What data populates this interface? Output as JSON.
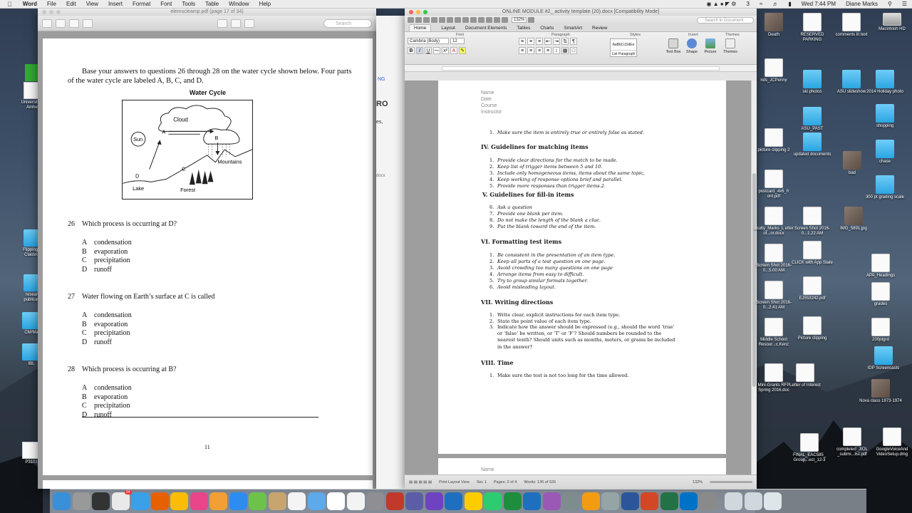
{
  "menubar": {
    "app": "Word",
    "items": [
      "File",
      "Edit",
      "View",
      "Insert",
      "Format",
      "Font",
      "Tools",
      "Table",
      "Window",
      "Help"
    ],
    "clock": "Wed 7:44 PM",
    "user": "Diane Marks",
    "battery_label": "3"
  },
  "pdf": {
    "title": "elemscieamp.pdf (page 17 of 34)",
    "search_placeholder": "Search",
    "intro": "Base your answers to questions 26 through 28 on the water cycle shown below.  Four parts of the water cycle are labeled A, B, C, and D.",
    "diagram_title": "Water Cycle",
    "diagram_labels": {
      "cloud": "Cloud",
      "sun": "Sun",
      "a": "A",
      "b": "B",
      "c": "C",
      "d": "D",
      "mountains": "Mountains",
      "lake": "Lake",
      "forest": "Forest"
    },
    "questions": [
      {
        "num": "26",
        "text": "Which process is occurring at D?",
        "options": [
          {
            "l": "A",
            "t": "condensation"
          },
          {
            "l": "B",
            "t": "evaporation"
          },
          {
            "l": "C",
            "t": "precipitation"
          },
          {
            "l": "D",
            "t": "runoff"
          }
        ]
      },
      {
        "num": "27",
        "text": "Water flowing on Earth’s surface at C is called",
        "options": [
          {
            "l": "A",
            "t": "condensation"
          },
          {
            "l": "B",
            "t": "evaporation"
          },
          {
            "l": "C",
            "t": "precipitation"
          },
          {
            "l": "D",
            "t": "runoff"
          }
        ]
      },
      {
        "num": "28",
        "text": "Which process is occurring at B?",
        "options": [
          {
            "l": "A",
            "t": "condensation"
          },
          {
            "l": "B",
            "t": "evaporation"
          },
          {
            "l": "C",
            "t": "precipitation"
          },
          {
            "l": "D",
            "t": "runoff"
          }
        ]
      }
    ],
    "page_number": "11"
  },
  "middle_window": {
    "fragments": [
      "NG",
      "RO",
      "es,",
      "docx"
    ]
  },
  "word": {
    "title": "ONLINE MODULE #2_ activity template (20).docx [Compatibility Mode]",
    "search_placeholder": "Search in Document",
    "zoom": "132%",
    "tabs": [
      "Home",
      "Layout",
      "Document Elements",
      "Tables",
      "Charts",
      "SmartArt",
      "Review"
    ],
    "ribbon_groups": [
      "Font",
      "Paragraph",
      "Styles",
      "Insert",
      "Themes"
    ],
    "font_name": "Cambria (Body)",
    "font_size": "12",
    "style_preview": "AaBbCcDdEe",
    "style_name": "List Paragraph",
    "insert_buttons": [
      "Text Box",
      "Shape",
      "Picture"
    ],
    "themes_button": "Themes",
    "header_lines": [
      "Name",
      "Date",
      "Course",
      "Instructor"
    ],
    "item_top": {
      "n": "1.",
      "t": "Make sure the item is entirely true or entirely false as stated."
    },
    "sections": [
      {
        "heading": "IV. Guidelines for matching items",
        "items": [
          {
            "n": "1.",
            "t": "Provide clear directions for the match to be made."
          },
          {
            "n": "2.",
            "t": "Keep list of trigger items between 5 and 10."
          },
          {
            "n": "3.",
            "t": "Include only homogeneous items, items about the same topic,"
          },
          {
            "n": "4.",
            "t": "Keep working of response options brief and parallel."
          },
          {
            "n": "5.",
            "t": "Provide more responses than trigger items.2."
          }
        ]
      },
      {
        "heading": "V.  Guidelines for fill-in items",
        "items": [
          {
            "n": "6.",
            "t": "Ask a question"
          },
          {
            "n": "7.",
            "t": "Provide one blank per item."
          },
          {
            "n": "8.",
            "t": "Do not make the length of the blank a clue."
          },
          {
            "n": "9.",
            "t": "Put the blank toward the end of the item."
          }
        ]
      },
      {
        "heading": "VI. Formatting test items",
        "items": [
          {
            "n": "1.",
            "t": "Be consistent in the presentation of an item type."
          },
          {
            "n": "2.",
            "t": "Keep all parts of a test question on one page."
          },
          {
            "n": "3.",
            "t": "Avoid crowding too many questions on one page"
          },
          {
            "n": "4.",
            "t": "Arrange items from easy to difficult."
          },
          {
            "n": "5.",
            "t": "Try to group similar formats together."
          },
          {
            "n": "6.",
            "t": "Avoid misleading layout."
          }
        ]
      },
      {
        "heading": "VII. Writing directions",
        "items": [
          {
            "n": "1.",
            "t": "Write clear, explicit instructions for each item type."
          },
          {
            "n": "2.",
            "t": "State the point value of each item type."
          },
          {
            "n": "3.",
            "t": "Indicate how the answer should be expressed (e.g., should the word ‘true’ or ‘false’ be written, or ‘T’ or ‘F’? Should numbers be rounded to the nearest tenth? Should units such as months, meters, or grams be included in the answer?"
          }
        ]
      },
      {
        "heading": "VIII. Time",
        "items": [
          {
            "n": "1.",
            "t": "Make sure the test is not too long for the time allowed."
          }
        ]
      }
    ],
    "next_page_header": "Name",
    "status": {
      "view": "Print Layout View",
      "sec": "Sec",
      "sec_val": "1",
      "pages": "Pages:",
      "pages_val": "2 of 4",
      "words": "Words:",
      "words_val": "136 of 526",
      "zoom": "132%"
    }
  },
  "desktop_icons": [
    {
      "label": "Death",
      "kind": "pic"
    },
    {
      "label": "RESERVED PARKING",
      "kind": "doc"
    },
    {
      "label": "comments lit text",
      "kind": "doc"
    },
    {
      "label": "Macintosh HD",
      "kind": "drive"
    },
    {
      "label": "nds_JCPenny",
      "kind": "doc"
    },
    {
      "label": "ski photos",
      "kind": "folder"
    },
    {
      "label": "ASU slideshow",
      "kind": "folder"
    },
    {
      "label": "2014 Holiday photo",
      "kind": "folder"
    },
    {
      "label": "ASU_PAST",
      "kind": "folder"
    },
    {
      "label": "shopping",
      "kind": "folder"
    },
    {
      "label": "picture clipping 2",
      "kind": "doc"
    },
    {
      "label": "updated documents",
      "kind": "folder"
    },
    {
      "label": "bad",
      "kind": "pic"
    },
    {
      "label": "chase",
      "kind": "folder"
    },
    {
      "label": "postcard_4x6_fr ont.pdf",
      "kind": "doc"
    },
    {
      "label": "300 pt grading scale",
      "kind": "folder"
    },
    {
      "label": "aculty_Marks_L etter of...or.docx",
      "kind": "doc"
    },
    {
      "label": "Screen Shot 2016-0...1.22 AM",
      "kind": "doc"
    },
    {
      "label": "IMG_5891.jpg",
      "kind": "pic"
    },
    {
      "label": "Screen Shot 2016-0...5.00 AM",
      "kind": "doc"
    },
    {
      "label": "CLICK with App State",
      "kind": "doc"
    },
    {
      "label": "APA_Headings",
      "kind": "doc"
    },
    {
      "label": "Screen Shot 2016-0...2.41 AM",
      "kind": "doc"
    },
    {
      "label": "EJ553242.pdf",
      "kind": "doc"
    },
    {
      "label": "grades",
      "kind": "doc"
    },
    {
      "label": "Middle School Resour...c.Kenz",
      "kind": "doc"
    },
    {
      "label": "Picture clipping",
      "kind": "doc"
    },
    {
      "label": "200ptgrd",
      "kind": "doc"
    },
    {
      "label": "IDP Screencasts",
      "kind": "folder"
    },
    {
      "label": "Mini-Grants RFP Spring 2016.doc",
      "kind": "doc"
    },
    {
      "label": "Letter of Interest",
      "kind": "doc"
    },
    {
      "label": "Nova class 1973-1974",
      "kind": "pic"
    },
    {
      "label": "FINAL_EAC585_ Group...ect_12-3",
      "kind": "doc"
    },
    {
      "label": "completed_JIOL _submi...list.pdf",
      "kind": "doc"
    },
    {
      "label": "GoogleVoiceAnd VideoSetup.dmg",
      "kind": "doc"
    }
  ],
  "left_icons": [
    {
      "label": "fa"
    },
    {
      "label": "University at Amher"
    },
    {
      "label": "Flipping th Classroo"
    },
    {
      "label": "researc publicatio"
    },
    {
      "label": "CM/Ma"
    },
    {
      "label": "IBL"
    },
    {
      "label": "P3101"
    }
  ],
  "dock_icons": [
    "finder",
    "launchpad",
    "dashboard",
    "mail",
    "safari",
    "firefox",
    "chrome",
    "itunes",
    "ibooks",
    "app-store",
    "messages",
    "contacts",
    "photos",
    "preview",
    "calendar",
    "textedit",
    "system-preferences",
    "photo-booth",
    "imovie",
    "siri",
    "quicktime",
    "emoji",
    "facetime",
    "numbers",
    "keynote",
    "photos-2",
    "image-capture",
    "pages",
    "scanner",
    "word",
    "powerpoint",
    "excel",
    "outlook",
    "script-editor",
    "documents",
    "downloads",
    "trash"
  ],
  "dock_badge": "34"
}
